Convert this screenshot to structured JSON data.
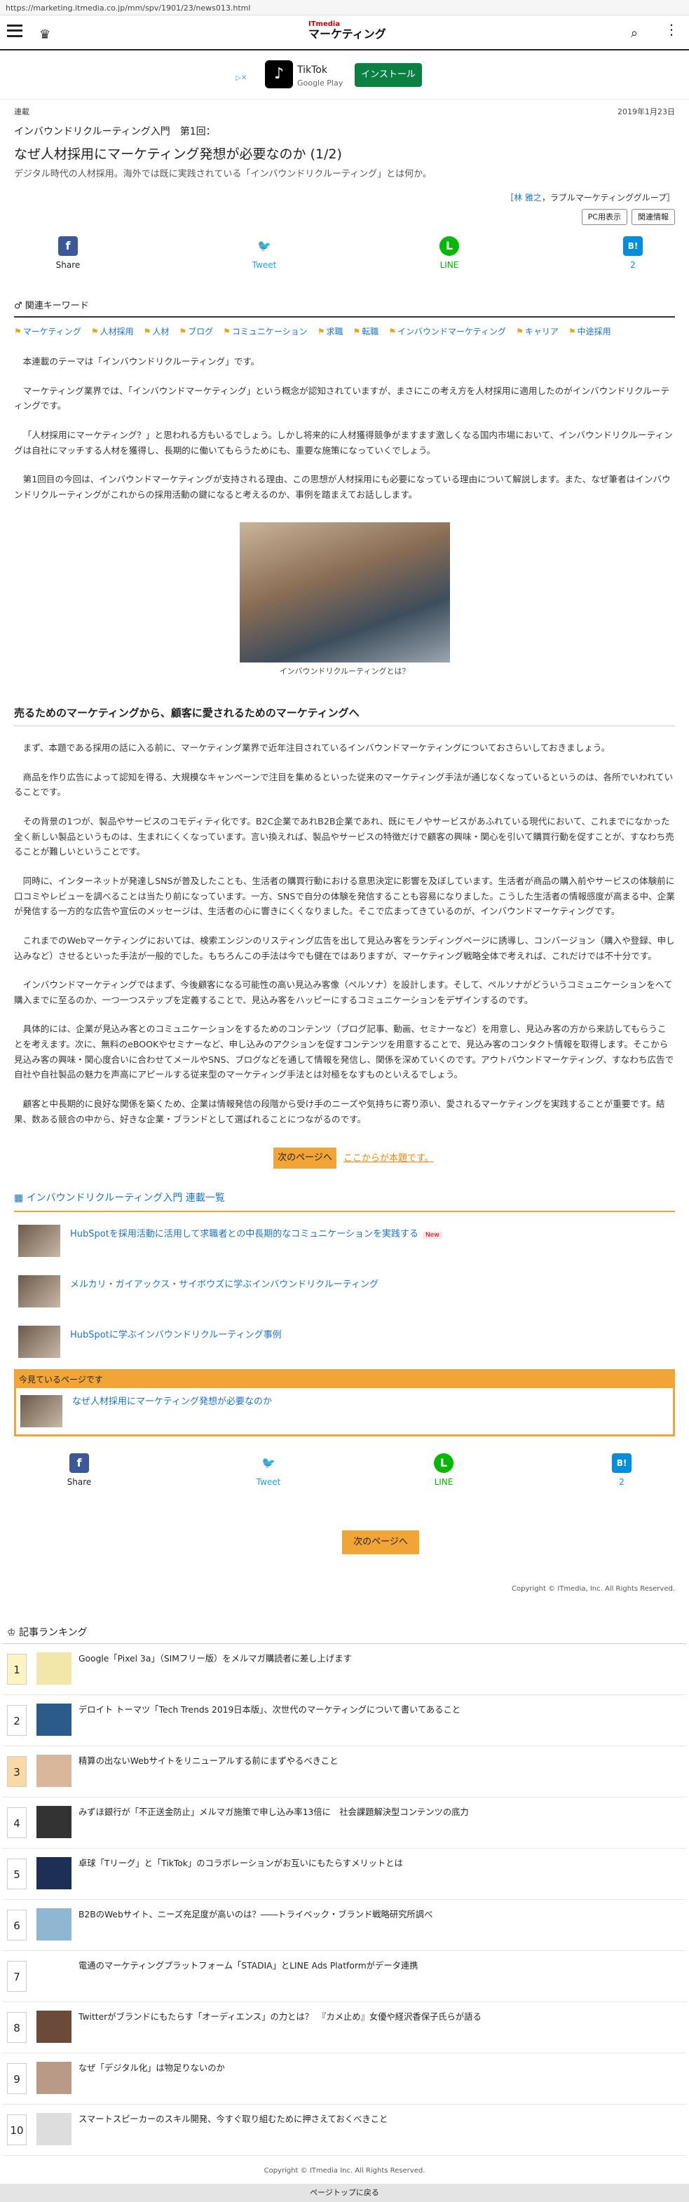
{
  "url": "https://marketing.itmedia.co.jp/mm/spv/1901/23/news013.html",
  "logo": {
    "line1": "ITmedia",
    "line2": "マーケティング"
  },
  "ad": {
    "info": "▷✕",
    "app": "TikTok",
    "store": "Google Play",
    "install": "インストール"
  },
  "meta": {
    "category": "連載",
    "date": "2019年1月23日"
  },
  "article": {
    "series": "インバウンドリクルーティング入門　第1回：",
    "title": "なぜ人材採用にマーケティング発想が必要なのか (1/2)",
    "lead": "デジタル時代の人材採用。海外では既に実践されている「インバウンドリクルーティング」とは何か。",
    "author_prefix": "［",
    "author": "林 雅之",
    "author_org": "，ラブルマーケティンググループ］",
    "tools": [
      "PC用表示",
      "関連情報"
    ]
  },
  "share": [
    {
      "label": "Share",
      "icon": "f",
      "color": "#3b5998"
    },
    {
      "label": "Tweet",
      "icon": "🐦",
      "color": "#1da1f2"
    },
    {
      "label": "LINE",
      "icon": "L",
      "color": "#00b900"
    },
    {
      "label": "2",
      "icon": "B!",
      "color": "#008fde"
    }
  ],
  "keywords": {
    "heading": "関連キーワード",
    "items": [
      "マーケティング",
      "人材採用",
      "人材",
      "ブログ",
      "コミュニケーション",
      "求職",
      "転職",
      "インバウンドマーケティング",
      "キャリア",
      "中途採用"
    ]
  },
  "body": [
    "本連載のテーマは「インバウンドリクルーティング」です。",
    "マーケティング業界では、「インバウンドマーケティング」という概念が認知されていますが、まさにこの考え方を人材採用に適用したのがインバウンドリクルーティングです。",
    "「人材採用にマーケティング？」と思われる方もいるでしょう。しかし将来的に人材獲得競争がますます激しくなる国内市場において、インバウンドリクルーティングは自社にマッチする人材を獲得し、長期的に働いてもらうためにも、重要な施策になっていくでしょう。",
    "第1回目の今回は、インバウンドマーケティングが支持される理由、この思想が人材採用にも必要になっている理由について解説します。また、なぜ筆者はインバウンドリクルーティングがこれからの採用活動の鍵になると考えるのか、事例を踏まえてお話しします。"
  ],
  "figure_caption": "インバウンドリクルーティングとは？",
  "section": {
    "heading": "売るためのマーケティングから、顧客に愛されるためのマーケティングへ",
    "paras": [
      "まず、本題である採用の話に入る前に、マーケティング業界で近年注目されているインバウンドマーケティングについておさらいしておきましょう。",
      "商品を作り広告によって認知を得る、大規模なキャンペーンで注目を集めるといった従来のマーケティング手法が通じなくなっているというのは、各所でいわれていることです。",
      "その背景の1つが、製品やサービスのコモディティ化です。B2C企業であれB2B企業であれ、既にモノやサービスがあふれている現代において、これまでになかった全く新しい製品というものは、生まれにくくなっています。言い換えれば、製品やサービスの特徴だけで顧客の興味・関心を引いて購買行動を促すことが、すなわち売ることが難しいということです。",
      "同時に、インターネットが発達しSNSが普及したことも、生活者の購買行動における意思決定に影響を及ぼしています。生活者が商品の購入前やサービスの体験前に口コミやレビューを調べることは当たり前になっています。一方、SNSで自分の体験を発信することも容易になりました。こうした生活者の情報感度が高まる中、企業が発信する一方的な広告や宣伝のメッセージは、生活者の心に響きにくくなりました。そこで広まってきているのが、インバウンドマーケティングです。",
      "これまでのWebマーケティングにおいては、検索エンジンのリスティング広告を出して見込み客をランディングページに誘導し、コンバージョン（購入や登録、申し込みなど）させるといった手法が一般的でした。もちろんこの手法は今でも健在ではありますが、マーケティング戦略全体で考えれば、これだけでは不十分です。",
      "インバウンドマーケティングではまず、今後顧客になる可能性の高い見込み客像（ペルソナ）を設計します。そして、ペルソナがどういうコミュニケーションをへて購入までに至るのか、一つ一つステップを定義することで、見込み客をハッピーにするコミュニケーションをデザインするのです。",
      "具体的には、企業が見込み客とのコミュニケーションをするためのコンテンツ（ブログ記事、動画、セミナーなど）を用意し、見込み客の方から来訪してもらうことを考えます。次に、無料のeBOOKやセミナーなど、申し込みのアクションを促すコンテンツを用意することで、見込み客のコンタクト情報を取得します。そこから見込み客の興味・関心度合いに合わせてメールやSNS、ブログなどを通して情報を発信し、関係を深めていくのです。アウトバウンドマーケティング、すなわち広告で自社や自社製品の魅力を声高にアピールする従来型のマーケティング手法とは対極をなすものといえるでしょう。",
      "顧客と中長期的に良好な関係を築くため、企業は情報発信の段階から受け手のニーズや気持ちに寄り添い、愛されるマーケティングを実践することが重要です。結果、数ある競合の中から、好きな企業・ブランドとして選ばれることにつながるのです。"
    ]
  },
  "next": {
    "button": "次のページへ",
    "link": "ここからが本題です。"
  },
  "series_list": {
    "heading": "インバウンドリクルーティング入門 連載一覧",
    "items": [
      {
        "title": "HubSpotを採用活動に活用して求職者との中長期的なコミュニケーションを実践する",
        "new": "New"
      },
      {
        "title": "メルカリ・ガイアックス・サイボウズに学ぶインバウンドリクルーティング",
        "new": ""
      },
      {
        "title": "HubSpotに学ぶインバウンドリクルーティング事例",
        "new": ""
      }
    ],
    "current_label": "今見ているページです",
    "current_title": "なぜ人材採用にマーケティング発想が必要なのか"
  },
  "next_page": "次のページへ",
  "copyright": "Copyright © ITmedia, Inc. All Rights Reserved.",
  "ranking": {
    "heading": "記事ランキング",
    "items": [
      {
        "n": "1",
        "title": "Google「Pixel 3a」（SIMフリー版）をメルマガ購読者に差し上げます",
        "bg": "#fff4c2",
        "thumb": "#f2e7a8"
      },
      {
        "n": "2",
        "title": "デロイト トーマツ「Tech Trends 2019日本版」、次世代のマーケティングについて書いてあること",
        "bg": "#fff",
        "thumb": "#2a5b8a"
      },
      {
        "n": "3",
        "title": "精算の出ないWebサイトをリニューアルする前にまずやるべきこと",
        "bg": "#f9d9a6",
        "thumb": "#d9b79b"
      },
      {
        "n": "4",
        "title": "みずほ銀行が「不正送金防止」メルマガ施策で申し込み率13倍に　社会課題解決型コンテンツの底力",
        "bg": "#fff",
        "thumb": "#333"
      },
      {
        "n": "5",
        "title": "卓球「Tリーグ」と「TikTok」のコラボレーションがお互いにもたらすメリットとは",
        "bg": "#fff",
        "thumb": "#1d2f55"
      },
      {
        "n": "6",
        "title": "B2BのWebサイト、ニーズ充足度が高いのは？――トライベック・ブランド戦略研究所調べ",
        "bg": "#fff",
        "thumb": "#8fb7d1"
      },
      {
        "n": "7",
        "title": "電通のマーケティングプラットフォーム「STADIA」とLINE Ads Platformがデータ連携",
        "bg": "#fff",
        "thumb": "#fff"
      },
      {
        "n": "8",
        "title": "Twitterがブランドにもたらす「オーディエンス」の力とは？　『カメ止め』女優や経沢香保子氏らが語る",
        "bg": "#fff",
        "thumb": "#6c4a3a"
      },
      {
        "n": "9",
        "title": "なぜ「デジタル化」は物足りないのか",
        "bg": "#fff",
        "thumb": "#b99a86"
      },
      {
        "n": "10",
        "title": "スマートスピーカーのスキル開発、今すぐ取り組むために押さえておくべきこと",
        "bg": "#fff",
        "thumb": "#ddd"
      }
    ]
  },
  "footer": {
    "copyright": "Copyright © ITmedia Inc. All Rights Reserved.",
    "totop": "ページトップに戻る"
  }
}
